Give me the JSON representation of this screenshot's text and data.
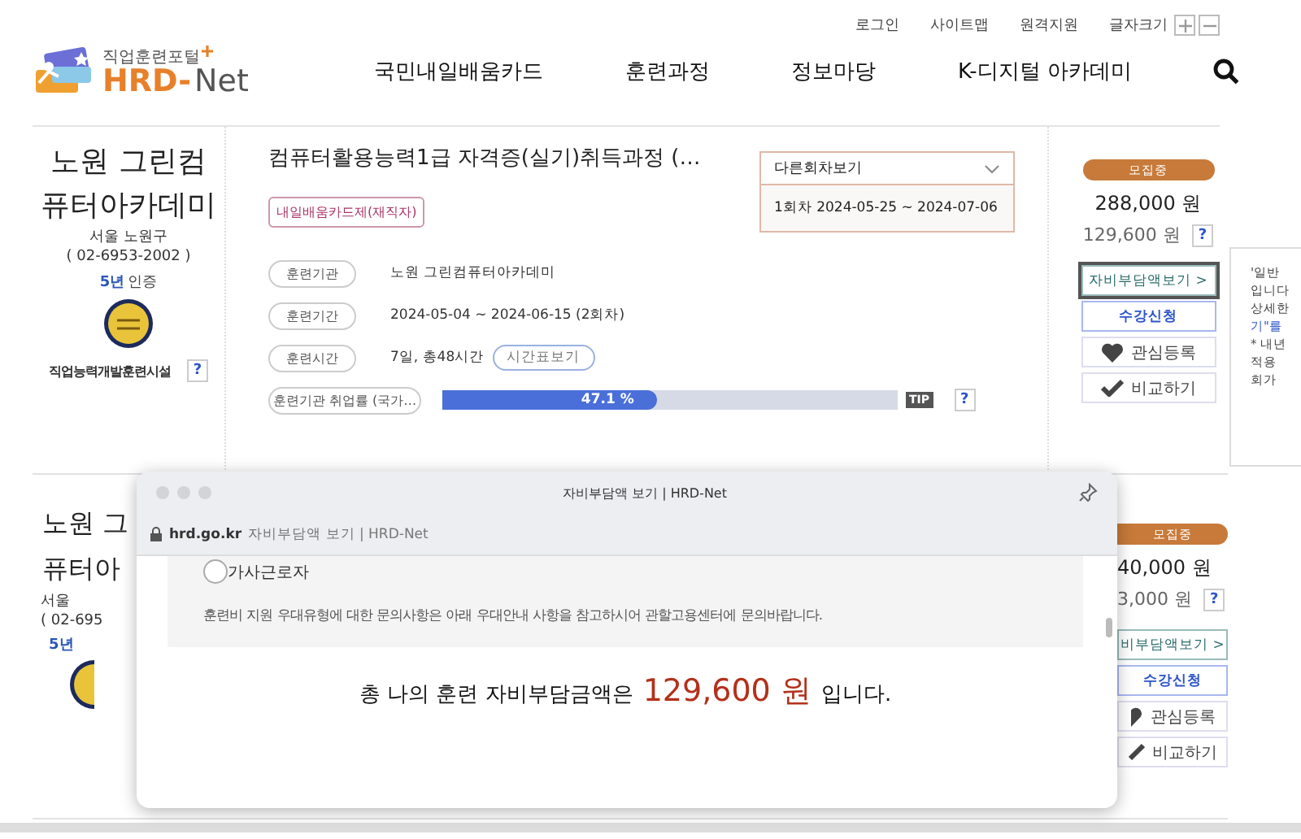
{
  "header": {
    "top_links": [
      "로그인",
      "사이트맵",
      "원격지원",
      "글자크기"
    ],
    "logo": {
      "tagline": "직업훈련포털",
      "brand": "HRD-",
      "brand_suffix": "Net"
    },
    "nav": [
      "국민내일배움카드",
      "훈련과정",
      "정보마당",
      "K-디지털 아카데미"
    ]
  },
  "course": {
    "institution": {
      "name": "노원 그린컴퓨터아카데미",
      "region": "서울 노원구",
      "phone": "( 02-6953-2002 )",
      "cert_years": "5년",
      "cert_label": "인증",
      "facility": "직업능력개발훈련시설",
      "help": "?"
    },
    "title": "컴퓨터활용능력1급 자격증(실기)취득과정 (…",
    "tag": "내일배움카드제(재직자)",
    "session_dropdown": {
      "label": "다른회차보기",
      "expanded": true,
      "options": [
        "1회차 2024-05-25 ~ 2024-07-06"
      ]
    },
    "info": [
      {
        "label": "훈련기관",
        "value": "노원 그린컴퓨터아카데미"
      },
      {
        "label": "훈련기간",
        "value": "2024-05-04 ~ 2024-06-15 (2회차)"
      },
      {
        "label": "훈련시간",
        "value": "7일, 총48시간",
        "button": "시간표보기"
      }
    ],
    "employment": {
      "label": "훈련기관 취업률 (국가…",
      "level": 0.471,
      "reading": "47.1 %",
      "tip": "TIP",
      "help": "?"
    },
    "status": "모집중",
    "price": "288,000 원",
    "self_pay": "129,600 원",
    "price_help": "?",
    "actions": [
      {
        "kind": "fee",
        "label": "자비부담액보기 >",
        "focused": true
      },
      {
        "kind": "apply",
        "label": "수강신청"
      },
      {
        "kind": "wish",
        "label": "관심등록"
      },
      {
        "kind": "compare",
        "label": "비교하기"
      }
    ]
  },
  "course_partial": {
    "name_lines": [
      "노원 그",
      "퓨터아"
    ],
    "region": "서울",
    "phone": "( 02-695",
    "cert_years": "5년",
    "status": "모집중",
    "price": "40,000 원",
    "self_pay": "3,000 원",
    "price_help": "?",
    "actions": [
      {
        "kind": "fee",
        "label": "비부담액보기 >",
        "focused": false
      },
      {
        "kind": "apply",
        "label": "수강신청"
      },
      {
        "kind": "wish",
        "label": "관심등록"
      },
      {
        "kind": "compare",
        "label": "비교하기"
      }
    ]
  },
  "tooltip": {
    "lines": [
      "'일반",
      "입니다",
      "상세한",
      "기\"를",
      "* 내년",
      "적용",
      "회가"
    ]
  },
  "popup": {
    "title": "자비부담액 보기 | HRD-Net",
    "domain": "hrd.go.kr",
    "page_title": "자비부담액 보기 | HRD-Net",
    "radio": {
      "label": "가사근로자",
      "checked": false
    },
    "notice": "훈련비 지원 우대유형에 대한 문의사항은 아래 우대안내 사항을 참고하시어 관할고용센터에 문의바랍니다.",
    "total_prefix": "총 나의 훈련 자비부담금액은",
    "total_amount": "129,600 원",
    "total_suffix": "입니다."
  }
}
